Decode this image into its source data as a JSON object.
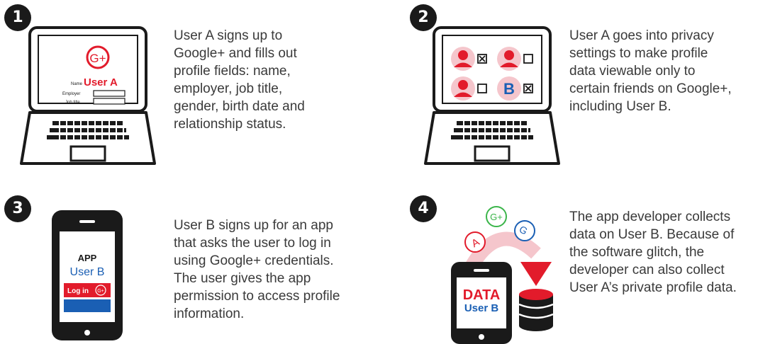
{
  "steps": [
    {
      "number": "1",
      "text": "User A signs up to\nGoogle+ and fills out\nprofile fields: name,\nemployer, job title,\ngender, birth date and\nrelationship status."
    },
    {
      "number": "2",
      "text": "User A goes into privacy\nsettings to make profile\ndata viewable only to\ncertain friends on Google+,\nincluding User B."
    },
    {
      "number": "3",
      "text": "User B signs up for an app\nthat asks the user to log in\nusing Google+ credentials.\nThe user gives the app\npermission to access profile\ninformation."
    },
    {
      "number": "4",
      "text": "The app developer collects\ndata on User B. Because of\nthe software glitch, the\ndeveloper can also collect\nUser A’s private profile data."
    }
  ],
  "laptop1": {
    "gplus": "G+",
    "name_label": "Name",
    "user": "User A",
    "employer_label": "Employer",
    "jobtitle_label": "Job title"
  },
  "laptop2": {
    "friend_b": "B"
  },
  "phone3": {
    "app": "APP",
    "user": "User B",
    "login": "Log in",
    "gplus": "G+"
  },
  "step4": {
    "bubble_a": "A",
    "bubble_g": "G+",
    "bubble_g2": "G",
    "data": "DATA",
    "user": "User B"
  },
  "colors": {
    "red": "#e21b2b",
    "pink": "#f5c6cc",
    "blue": "#1a5fb4",
    "green": "#3bb54a",
    "dark": "#1a1a1a"
  }
}
